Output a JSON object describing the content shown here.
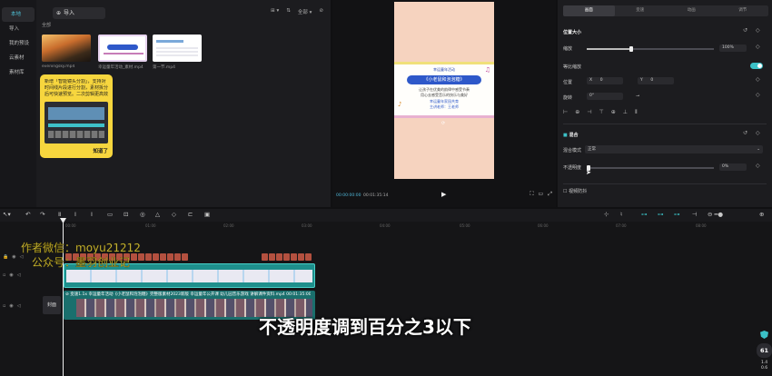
{
  "sidebar": {
    "items": [
      {
        "label": "本地",
        "active": true
      },
      {
        "label": "导入"
      },
      {
        "label": "我的预设"
      },
      {
        "label": "云素材"
      },
      {
        "label": "素材库"
      }
    ]
  },
  "media": {
    "import_label": "导入",
    "tools": [
      "⊞ ▾",
      "⇅",
      "全部 ▾",
      "⊘"
    ],
    "section_label": "全部",
    "items": [
      {
        "caption": "eveningsky.mp4"
      },
      {
        "caption": "幸运童年活动_素材.mp4"
      },
      {
        "caption": "第一节.mp4"
      }
    ],
    "tip": {
      "text": "新增「智能镜头分割」，支持对时间线片段进行分割，素材拆分后可快速预览。二次剪辑更高效",
      "button": "知道了"
    }
  },
  "player": {
    "card": {
      "top_text": "幸运童年活动",
      "title": "《小老鼠和泡泡糖》",
      "line1": "让孩子在优美的韵律中感受节奏",
      "line2": "用心去感受音乐的快乐与美好",
      "line3": "幸运童年家园共育",
      "line4": "主讲老师：王老师"
    },
    "current_time": "00:00:00:00",
    "total_time": "00:01:35:14"
  },
  "props": {
    "tabs": [
      "画面",
      "变速",
      "动画",
      "调节"
    ],
    "section_position": "位置大小",
    "scale_label": "缩放",
    "scale_value": "100%",
    "scale_fraction": 0.35,
    "uniform_label": "等比缩放",
    "position_label": "位置",
    "pos_x_label": "X",
    "pos_x": "0",
    "pos_y_label": "Y",
    "pos_y": "0",
    "rotate_label": "旋转",
    "rotate_value": "0°",
    "section_blend": "混合",
    "blend_mode_label": "混合模式",
    "blend_mode_value": "正常",
    "opacity_label": "不透明度",
    "opacity_value": "0%",
    "opacity_fraction": 0.0,
    "video_anti_shake": "视频防抖"
  },
  "timeline": {
    "ruler": [
      "00:00",
      "01:00",
      "02:00",
      "03:00",
      "04:00",
      "05:00",
      "06:00",
      "07:00",
      "08:00",
      "09:00"
    ],
    "cover_label": "封面",
    "main_clip_label": "⊘ 变速1.1x  幸运童年活动《小老鼠和泡泡糖》完整版素材2023新版 幸运童年公开课 幼儿园音乐游戏  讲解课件资料.mp4  00:01:35:00"
  },
  "watermark": {
    "line1": "作者微信：moyu21212",
    "line2": "公众号：墨羽创业记"
  },
  "subtitle": "不透明度调到百分之3以下",
  "zoom": {
    "badge": "61",
    "small_top": "1.4",
    "small_bottom": "0.6"
  },
  "colors": {
    "accent": "#3bc0c6",
    "tip_yellow": "#f7d63e",
    "clip_teal": "#1e8f8c"
  }
}
